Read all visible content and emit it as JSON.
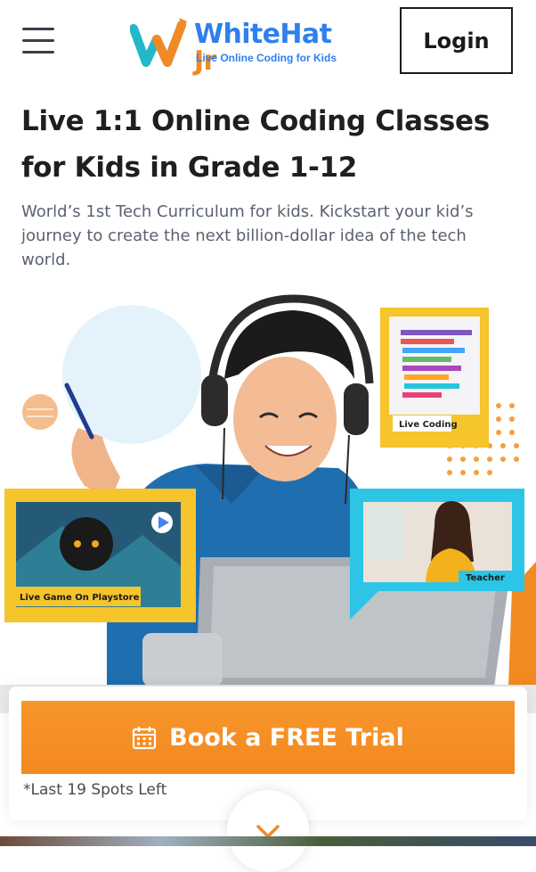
{
  "header": {
    "menu_icon": "hamburger-menu-icon",
    "logo": {
      "brand": "WhiteHat",
      "brand_suffix": "Jr",
      "tagline": "Live Online Coding for Kids"
    },
    "login_label": "Login"
  },
  "hero": {
    "headline_line1": "Live 1:1 Online Coding Classes",
    "headline_line2": "for Kids in Grade 1-12",
    "description": "World’s 1st Tech Curriculum for kids. Kickstart your kid’s journey to create the next billion-dollar idea of the tech world.",
    "cards": {
      "live_coding": "Live Coding",
      "live_game": "Live Game On Playstore",
      "teacher": "Teacher"
    }
  },
  "cta": {
    "icon": "calendar-icon",
    "label": "Book a FREE Trial",
    "spots_note": "*Last 19 Spots Left"
  },
  "scroll": {
    "icon": "chevron-down-icon"
  },
  "colors": {
    "brand_blue": "#2f80ed",
    "brand_orange": "#f08a24",
    "cta_orange": "#f7962c",
    "card_yellow": "#f6c42b",
    "card_cyan": "#2cc5e6"
  }
}
